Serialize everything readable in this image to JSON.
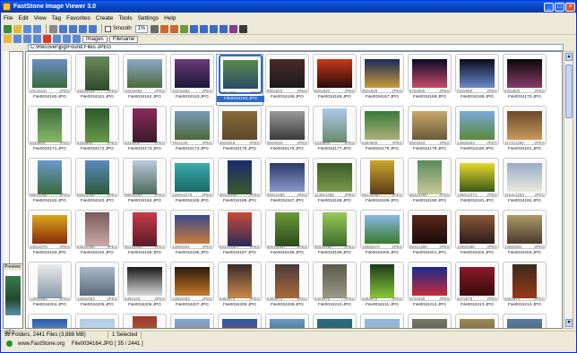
{
  "window": {
    "title": "FastStone Image Viewer 3.0",
    "minimize": "_",
    "maximize": "□",
    "close": "×"
  },
  "menu": [
    "File",
    "Edit",
    "View",
    "Tag",
    "Favorites",
    "Create",
    "Tools",
    "Settings",
    "Help"
  ],
  "toolbar": {
    "zoom_value": "1%",
    "smooth_label": "Smooth",
    "view_mode": "Images",
    "sort": "Filename"
  },
  "path": "C:\\Recover\\jpg\\Found Files JPEG",
  "left_panel": {
    "preview_header": "Preview",
    "count": "972"
  },
  "thumbnails": [
    {
      "dims": "1024x541",
      "type": "JPEG",
      "name": "File0034160.JPG",
      "c1": "#6b8fc7",
      "c2": "#3a6b3a"
    },
    {
      "dims": "482x1224",
      "type": "JPEG",
      "name": "File0034161.JPG",
      "c1": "#6a8b5a",
      "c2": "#2e4a2a",
      "p": true
    },
    {
      "dims": "1024x682",
      "type": "JPEG",
      "name": "File0034162.JPG",
      "c1": "#8aa8c8",
      "c2": "#4d6b3a"
    },
    {
      "dims": "1224x682",
      "type": "JPEG",
      "name": "File0034163.JPG",
      "c1": "#6a3a7a",
      "c2": "#1a1a3a"
    },
    {
      "dims": "572x800",
      "type": "JPEG",
      "name": "File0034164.JPG",
      "c1": "#5a8a4a",
      "c2": "#2a4a6a",
      "sel": true
    },
    {
      "dims": "800x533",
      "type": "JPEG",
      "name": "File0034165.JPG",
      "c1": "#4a2a2a",
      "c2": "#1a1a1a"
    },
    {
      "dims": "800x524",
      "type": "JPEG",
      "name": "File0034166.JPG",
      "c1": "#c83a1a",
      "c2": "#2a0a0a"
    },
    {
      "dims": "800x533",
      "type": "JPEG",
      "name": "File0034167.JPG",
      "c1": "#1a2a5a",
      "c2": "#c89a3a"
    },
    {
      "dims": "676x800",
      "type": "JPEG",
      "name": "File0034168.JPG",
      "c1": "#0a0a2a",
      "c2": "#c84a6a"
    },
    {
      "dims": "533x800",
      "type": "JPEG",
      "name": "File0034169.JPG",
      "c1": "#0a0a1a",
      "c2": "#6a8aca"
    },
    {
      "dims": "533x800",
      "type": "JPEG",
      "name": "File0034170.JPG",
      "c1": "#0a0a0a",
      "c2": "#8a3a6a"
    },
    {
      "dims": "533x800",
      "type": "JPEG",
      "name": "File0034171.JPG",
      "c1": "#3a6a3a",
      "c2": "#8aba6a",
      "p": true
    },
    {
      "dims": "533x800",
      "type": "JPEG",
      "name": "File0034172.JPG",
      "c1": "#2a5a2a",
      "c2": "#6a9a4a",
      "p": true
    },
    {
      "dims": "633x800",
      "type": "JPEG",
      "name": "File0034173.JPG",
      "c1": "#8a2a5a",
      "c2": "#3a1a2a",
      "p": true
    },
    {
      "dims": "794x133",
      "type": "JPEG",
      "name": "File0034174.JPG",
      "c1": "#7a9aba",
      "c2": "#4a6a3a"
    },
    {
      "dims": "800x618",
      "type": "JPEG",
      "name": "File0034175.JPG",
      "c1": "#8a6a3a",
      "c2": "#5a4a2a"
    },
    {
      "dims": "800x533",
      "type": "JPEG",
      "name": "File0034176.JPG",
      "c1": "#9a9a9a",
      "c2": "#3a3a3a"
    },
    {
      "dims": "533x800",
      "type": "JPEG",
      "name": "File0034177.JPG",
      "c1": "#aacaea",
      "c2": "#6a8a6a",
      "p": true
    },
    {
      "dims": "648x800",
      "type": "JPEG",
      "name": "File0034178.JPG",
      "c1": "#3a7a3a",
      "c2": "#aab07a"
    },
    {
      "dims": "800x533",
      "type": "JPEG",
      "name": "File0034179.JPG",
      "c1": "#c8a86a",
      "c2": "#6a5a3a"
    },
    {
      "dims": "1280x853",
      "type": "JPEG",
      "name": "File0034180.JPG",
      "c1": "#7aaada",
      "c2": "#5a8a3a"
    },
    {
      "dims": "1173x1280",
      "type": "JPEG",
      "name": "File0034181.JPG",
      "c1": "#6a4a2a",
      "c2": "#c89a5a"
    },
    {
      "dims": "995x1280",
      "type": "JPEG",
      "name": "File0034182.JPG",
      "c1": "#6a9aca",
      "c2": "#3a6a3a",
      "p": true
    },
    {
      "dims": "855x1280",
      "type": "JPEG",
      "name": "File0034183.JPG",
      "c1": "#5a8aba",
      "c2": "#2a5a3a",
      "p": true
    },
    {
      "dims": "995x1280",
      "type": "JPEG",
      "name": "File0034184.JPG",
      "c1": "#bacada",
      "c2": "#4a6a5a",
      "p": true
    },
    {
      "dims": "1280x1279",
      "type": "JPEG",
      "name": "File0034185.JPG",
      "c1": "#3aaaaa",
      "c2": "#1a6a6a"
    },
    {
      "dims": "800x1280",
      "type": "JPEG",
      "name": "File0034186.JPG",
      "c1": "#1a2a6a",
      "c2": "#3a5a2a",
      "p": true
    },
    {
      "dims": "900x1280",
      "type": "JPEG",
      "name": "File0034187.JPG",
      "c1": "#2a3a6a",
      "c2": "#8a9aca"
    },
    {
      "dims": "1138x1280",
      "type": "JPEG",
      "name": "File0034188.JPG",
      "c1": "#3a5a2a",
      "c2": "#7a9a4a"
    },
    {
      "dims": "861x1280",
      "type": "JPEG",
      "name": "File0034189.JPG",
      "c1": "#c8a82a",
      "c2": "#5a3a1a",
      "p": true
    },
    {
      "dims": "853x1280",
      "type": "JPEG",
      "name": "File0034190.JPG",
      "c1": "#5a8a5a",
      "c2": "#caca9a",
      "p": true
    },
    {
      "dims": "1280x1071",
      "type": "JPEG",
      "name": "File0034191.JPG",
      "c1": "#e8d82a",
      "c2": "#3a5a1a"
    },
    {
      "dims": "1163x1280",
      "type": "JPEG",
      "name": "File0034192.JPG",
      "c1": "#9aaaca",
      "c2": "#eaeada"
    },
    {
      "dims": "1062x670",
      "type": "JPEG",
      "name": "File0034193.JPG",
      "c1": "#d8a81a",
      "c2": "#8a2a0a"
    },
    {
      "dims": "835x1280",
      "type": "JPEG",
      "name": "File0034194.JPG",
      "c1": "#7a5a5a",
      "c2": "#caaaaa",
      "p": true
    },
    {
      "dims": "853x1280",
      "type": "JPEG",
      "name": "File0034195.JPG",
      "c1": "#c83a4a",
      "c2": "#5a1a2a",
      "p": true
    },
    {
      "dims": "1280x561",
      "type": "JPEG",
      "name": "File0034196.JPG",
      "c1": "#3a4a8a",
      "c2": "#ca7a3a"
    },
    {
      "dims": "853x1280",
      "type": "JPEG",
      "name": "File0034197.JPG",
      "c1": "#c84a3a",
      "c2": "#2a2a5a",
      "p": true
    },
    {
      "dims": "900x1280",
      "type": "JPEG",
      "name": "File0034198.JPG",
      "c1": "#6a9a3a",
      "c2": "#2a4a1a",
      "p": true
    },
    {
      "dims": "900x1280",
      "type": "JPEG",
      "name": "File0034199.JPG",
      "c1": "#9aca5a",
      "c2": "#3a6a2a",
      "p": true
    },
    {
      "dims": "1280x574",
      "type": "JPEG",
      "name": "File0034200.JPG",
      "c1": "#8ab8e8",
      "c2": "#3a7a2a"
    },
    {
      "dims": "853x1280",
      "type": "JPEG",
      "name": "File0034201.JPG",
      "c1": "#5a2a1a",
      "c2": "#1a0a0a"
    },
    {
      "dims": "1280x960",
      "type": "JPEG",
      "name": "File0034202.JPG",
      "c1": "#8a5a3a",
      "c2": "#2a1a1a"
    },
    {
      "dims": "1280x821",
      "type": "JPEG",
      "name": "File0034203.JPG",
      "c1": "#aa9a6a",
      "c2": "#4a3a2a"
    },
    {
      "dims": "1280x853",
      "type": "JPEG",
      "name": "File0034204.JPG",
      "c1": "#eaeaea",
      "c2": "#8a9aaa",
      "p": true
    },
    {
      "dims": "1280x853",
      "type": "JPEG",
      "name": "File0034205.JPG",
      "c1": "#aabaca",
      "c2": "#5a6a7a"
    },
    {
      "dims": "649x422",
      "type": "JPEG",
      "name": "File0034206.JPG",
      "c1": "#1a1a1a",
      "c2": "#d8d8d8"
    },
    {
      "dims": "1280x853",
      "type": "JPEG",
      "name": "File0034207.JPG",
      "c1": "#2a1a0a",
      "c2": "#c87a2a"
    },
    {
      "dims": "648x972",
      "type": "JPEG",
      "name": "File0034208.JPG",
      "c1": "#3a2a2a",
      "c2": "#ca8a4a",
      "p": true
    },
    {
      "dims": "648x972",
      "type": "JPEG",
      "name": "File0034209.JPG",
      "c1": "#4a3a3a",
      "c2": "#aa6a3a",
      "p": true
    },
    {
      "dims": "648x972",
      "type": "JPEG",
      "name": "File0034210.JPG",
      "c1": "#5a5a4a",
      "c2": "#9a9a8a",
      "p": true
    },
    {
      "dims": "648x972",
      "type": "JPEG",
      "name": "File0034211.JPG",
      "c1": "#1a3a1a",
      "c2": "#8ac83a",
      "p": true
    },
    {
      "dims": "972x648",
      "type": "JPEG",
      "name": "File0034212.JPG",
      "c1": "#1a2a8a",
      "c2": "#c82a3a"
    },
    {
      "dims": "647x576",
      "type": "JPEG",
      "name": "File0034213.JPG",
      "c1": "#8a1a2a",
      "c2": "#3a0a0a"
    },
    {
      "dims": "648x972",
      "type": "JPEG",
      "name": "File0034214.JPG",
      "c1": "#3a2a1a",
      "c2": "#9a3a1a",
      "p": true
    },
    {
      "dims": "",
      "type": "",
      "name": "",
      "c1": "#2a5aaa",
      "c2": "#aacaea"
    },
    {
      "dims": "",
      "type": "",
      "name": "",
      "c1": "#aacae8",
      "c2": "#eaeaea"
    },
    {
      "dims": "",
      "type": "",
      "name": "",
      "c1": "#9a3a2a",
      "c2": "#ca7a4a",
      "p": true
    },
    {
      "dims": "",
      "type": "",
      "name": "",
      "c1": "#7aa8d8",
      "c2": "#b86a3a"
    },
    {
      "dims": "",
      "type": "",
      "name": "",
      "c1": "#2a5aaa",
      "c2": "#b84a2a"
    },
    {
      "dims": "",
      "type": "",
      "name": "",
      "c1": "#6a9aca",
      "c2": "#2a4a3a"
    },
    {
      "dims": "",
      "type": "",
      "name": "",
      "c1": "#2a6a8a",
      "c2": "#3a5a2a"
    },
    {
      "dims": "",
      "type": "",
      "name": "",
      "c1": "#8ab8e8",
      "c2": "#caa86a"
    },
    {
      "dims": "",
      "type": "",
      "name": "",
      "c1": "#7a7a6a",
      "c2": "#3a3a2a"
    },
    {
      "dims": "",
      "type": "",
      "name": "",
      "c1": "#9a8a5a",
      "c2": "#5a4a2a"
    },
    {
      "dims": "",
      "type": "",
      "name": "",
      "c1": "#5a7aaa",
      "c2": "#3a5a2a"
    }
  ],
  "status": {
    "folders": "58 Folders, 2441 Files (3,888 MB)",
    "selected": "1 Selected",
    "current": "File0034164.JPG [ 35 / 2441 ]",
    "site": "www.FastStone.org"
  }
}
